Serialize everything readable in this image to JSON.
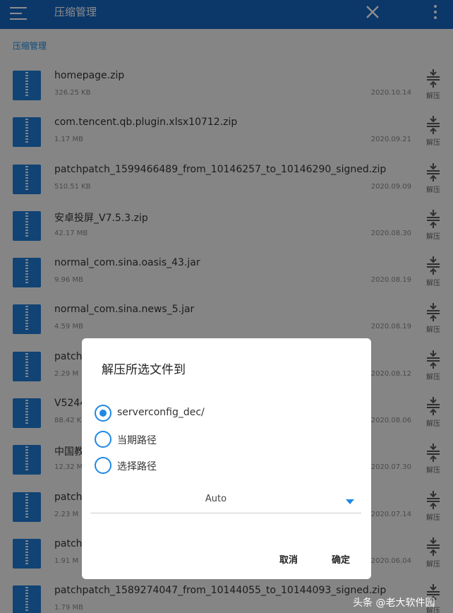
{
  "appbar": {
    "title": "压缩管理",
    "menu_icon": "hamburger-menu-icon",
    "close_icon": "close-icon",
    "more_icon": "more-vert-icon"
  },
  "breadcrumb": "压缩管理",
  "colors": {
    "primary": "#1565c0",
    "accent": "#1e88e5",
    "file_icon": "#1f7ad4"
  },
  "file_icon": "zip-file-icon",
  "extract_icon": "extract-arrows-icon",
  "files": [
    {
      "name": "homepage.zip",
      "size": "326.25 KB",
      "date": "2020.10.14",
      "action": "解压"
    },
    {
      "name": "com.tencent.qb.plugin.xlsx10712.zip",
      "size": "1.17 MB",
      "date": "2020.09.21",
      "action": "解压"
    },
    {
      "name": "patchpatch_1599466489_from_10146257_to_10146290_signed.zip",
      "size": "510.51 KB",
      "date": "2020.09.09",
      "action": "解压"
    },
    {
      "name": "安卓投屏_V7.5.3.zip",
      "size": "42.17 MB",
      "date": "2020.08.30",
      "action": "解压"
    },
    {
      "name": "normal_com.sina.oasis_43.jar",
      "size": "9.96 MB",
      "date": "2020.08.19",
      "action": "解压"
    },
    {
      "name": "normal_com.sina.news_5.jar",
      "size": "4.59 MB",
      "date": "2020.08.19",
      "action": "解压"
    },
    {
      "name": "patchp",
      "size": "2.29 M",
      "date": "2020.08.12",
      "action": "解压"
    },
    {
      "name": "V5244",
      "size": "88.42 K",
      "date": "2020.08.06",
      "action": "解压"
    },
    {
      "name": "中国教",
      "size": "12.32 M",
      "date": "2020.07.30",
      "action": "解压"
    },
    {
      "name": "patchp",
      "size": "2.23 M",
      "date": "2020.07.14",
      "action": "解压"
    },
    {
      "name": "patchp",
      "size": "1.91 M",
      "date": "2020.06.04",
      "action": "解压"
    },
    {
      "name": "patchpatch_1589274047_from_10144055_to_10144093_signed.zip",
      "size": "1.79 MB",
      "date": "",
      "action": "解压"
    }
  ],
  "dialog": {
    "title": "解压所选文件到",
    "options": [
      {
        "label": "serverconfig_dec/",
        "selected": true
      },
      {
        "label": "当期路径",
        "selected": false
      },
      {
        "label": "选择路径",
        "selected": false
      }
    ],
    "encoding_value": "Auto",
    "cancel_label": "取消",
    "confirm_label": "确定"
  },
  "watermark": "头条 @老大软件园"
}
